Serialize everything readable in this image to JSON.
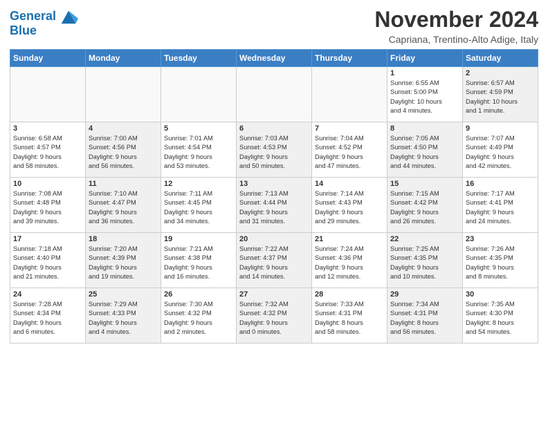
{
  "logo": {
    "line1": "General",
    "line2": "Blue"
  },
  "title": "November 2024",
  "subtitle": "Capriana, Trentino-Alto Adige, Italy",
  "days_of_week": [
    "Sunday",
    "Monday",
    "Tuesday",
    "Wednesday",
    "Thursday",
    "Friday",
    "Saturday"
  ],
  "weeks": [
    [
      {
        "day": "",
        "info": "",
        "shade": false,
        "empty": true
      },
      {
        "day": "",
        "info": "",
        "shade": false,
        "empty": true
      },
      {
        "day": "",
        "info": "",
        "shade": false,
        "empty": true
      },
      {
        "day": "",
        "info": "",
        "shade": false,
        "empty": true
      },
      {
        "day": "",
        "info": "",
        "shade": false,
        "empty": true
      },
      {
        "day": "1",
        "info": "Sunrise: 6:55 AM\nSunset: 5:00 PM\nDaylight: 10 hours\nand 4 minutes.",
        "shade": false,
        "empty": false
      },
      {
        "day": "2",
        "info": "Sunrise: 6:57 AM\nSunset: 4:59 PM\nDaylight: 10 hours\nand 1 minute.",
        "shade": true,
        "empty": false
      }
    ],
    [
      {
        "day": "3",
        "info": "Sunrise: 6:58 AM\nSunset: 4:57 PM\nDaylight: 9 hours\nand 58 minutes.",
        "shade": false,
        "empty": false
      },
      {
        "day": "4",
        "info": "Sunrise: 7:00 AM\nSunset: 4:56 PM\nDaylight: 9 hours\nand 56 minutes.",
        "shade": true,
        "empty": false
      },
      {
        "day": "5",
        "info": "Sunrise: 7:01 AM\nSunset: 4:54 PM\nDaylight: 9 hours\nand 53 minutes.",
        "shade": false,
        "empty": false
      },
      {
        "day": "6",
        "info": "Sunrise: 7:03 AM\nSunset: 4:53 PM\nDaylight: 9 hours\nand 50 minutes.",
        "shade": true,
        "empty": false
      },
      {
        "day": "7",
        "info": "Sunrise: 7:04 AM\nSunset: 4:52 PM\nDaylight: 9 hours\nand 47 minutes.",
        "shade": false,
        "empty": false
      },
      {
        "day": "8",
        "info": "Sunrise: 7:05 AM\nSunset: 4:50 PM\nDaylight: 9 hours\nand 44 minutes.",
        "shade": true,
        "empty": false
      },
      {
        "day": "9",
        "info": "Sunrise: 7:07 AM\nSunset: 4:49 PM\nDaylight: 9 hours\nand 42 minutes.",
        "shade": false,
        "empty": false
      }
    ],
    [
      {
        "day": "10",
        "info": "Sunrise: 7:08 AM\nSunset: 4:48 PM\nDaylight: 9 hours\nand 39 minutes.",
        "shade": false,
        "empty": false
      },
      {
        "day": "11",
        "info": "Sunrise: 7:10 AM\nSunset: 4:47 PM\nDaylight: 9 hours\nand 36 minutes.",
        "shade": true,
        "empty": false
      },
      {
        "day": "12",
        "info": "Sunrise: 7:11 AM\nSunset: 4:45 PM\nDaylight: 9 hours\nand 34 minutes.",
        "shade": false,
        "empty": false
      },
      {
        "day": "13",
        "info": "Sunrise: 7:13 AM\nSunset: 4:44 PM\nDaylight: 9 hours\nand 31 minutes.",
        "shade": true,
        "empty": false
      },
      {
        "day": "14",
        "info": "Sunrise: 7:14 AM\nSunset: 4:43 PM\nDaylight: 9 hours\nand 29 minutes.",
        "shade": false,
        "empty": false
      },
      {
        "day": "15",
        "info": "Sunrise: 7:15 AM\nSunset: 4:42 PM\nDaylight: 9 hours\nand 26 minutes.",
        "shade": true,
        "empty": false
      },
      {
        "day": "16",
        "info": "Sunrise: 7:17 AM\nSunset: 4:41 PM\nDaylight: 9 hours\nand 24 minutes.",
        "shade": false,
        "empty": false
      }
    ],
    [
      {
        "day": "17",
        "info": "Sunrise: 7:18 AM\nSunset: 4:40 PM\nDaylight: 9 hours\nand 21 minutes.",
        "shade": false,
        "empty": false
      },
      {
        "day": "18",
        "info": "Sunrise: 7:20 AM\nSunset: 4:39 PM\nDaylight: 9 hours\nand 19 minutes.",
        "shade": true,
        "empty": false
      },
      {
        "day": "19",
        "info": "Sunrise: 7:21 AM\nSunset: 4:38 PM\nDaylight: 9 hours\nand 16 minutes.",
        "shade": false,
        "empty": false
      },
      {
        "day": "20",
        "info": "Sunrise: 7:22 AM\nSunset: 4:37 PM\nDaylight: 9 hours\nand 14 minutes.",
        "shade": true,
        "empty": false
      },
      {
        "day": "21",
        "info": "Sunrise: 7:24 AM\nSunset: 4:36 PM\nDaylight: 9 hours\nand 12 minutes.",
        "shade": false,
        "empty": false
      },
      {
        "day": "22",
        "info": "Sunrise: 7:25 AM\nSunset: 4:35 PM\nDaylight: 9 hours\nand 10 minutes.",
        "shade": true,
        "empty": false
      },
      {
        "day": "23",
        "info": "Sunrise: 7:26 AM\nSunset: 4:35 PM\nDaylight: 9 hours\nand 8 minutes.",
        "shade": false,
        "empty": false
      }
    ],
    [
      {
        "day": "24",
        "info": "Sunrise: 7:28 AM\nSunset: 4:34 PM\nDaylight: 9 hours\nand 6 minutes.",
        "shade": false,
        "empty": false
      },
      {
        "day": "25",
        "info": "Sunrise: 7:29 AM\nSunset: 4:33 PM\nDaylight: 9 hours\nand 4 minutes.",
        "shade": true,
        "empty": false
      },
      {
        "day": "26",
        "info": "Sunrise: 7:30 AM\nSunset: 4:32 PM\nDaylight: 9 hours\nand 2 minutes.",
        "shade": false,
        "empty": false
      },
      {
        "day": "27",
        "info": "Sunrise: 7:32 AM\nSunset: 4:32 PM\nDaylight: 9 hours\nand 0 minutes.",
        "shade": true,
        "empty": false
      },
      {
        "day": "28",
        "info": "Sunrise: 7:33 AM\nSunset: 4:31 PM\nDaylight: 8 hours\nand 58 minutes.",
        "shade": false,
        "empty": false
      },
      {
        "day": "29",
        "info": "Sunrise: 7:34 AM\nSunset: 4:31 PM\nDaylight: 8 hours\nand 56 minutes.",
        "shade": true,
        "empty": false
      },
      {
        "day": "30",
        "info": "Sunrise: 7:35 AM\nSunset: 4:30 PM\nDaylight: 8 hours\nand 54 minutes.",
        "shade": false,
        "empty": false
      }
    ]
  ]
}
